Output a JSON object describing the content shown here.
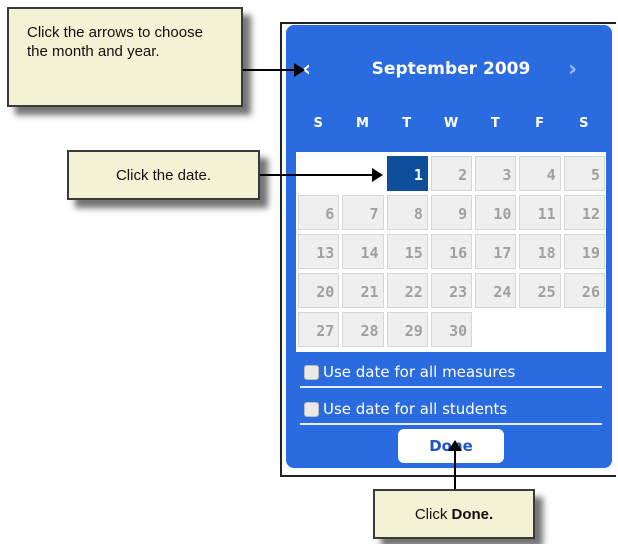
{
  "callouts": {
    "arrows_text": "Click the arrows to choose the month and year.",
    "date_text": "Click the date.",
    "done_prefix": "Click",
    "done_bold": "Done."
  },
  "picker": {
    "prev_icon": "‹",
    "next_icon": "›",
    "month_title": "September 2009",
    "days_of_week": [
      "S",
      "M",
      "T",
      "W",
      "T",
      "F",
      "S"
    ],
    "weeks": [
      [
        "",
        "",
        "1",
        "2",
        "3",
        "4",
        "5"
      ],
      [
        "6",
        "7",
        "8",
        "9",
        "10",
        "11",
        "12"
      ],
      [
        "13",
        "14",
        "15",
        "16",
        "17",
        "18",
        "19"
      ],
      [
        "20",
        "21",
        "22",
        "23",
        "24",
        "25",
        "26"
      ],
      [
        "27",
        "28",
        "29",
        "30",
        "",
        "",
        ""
      ]
    ],
    "selected_day": "1",
    "options": {
      "use_all_measures": "Use date for all measures",
      "use_all_students": "Use date for all students"
    },
    "done_label": "Done"
  },
  "colors": {
    "picker_bg": "#2b6be0",
    "selected_day": "#0d4f9a",
    "callout_bg": "#f2f2d4"
  }
}
